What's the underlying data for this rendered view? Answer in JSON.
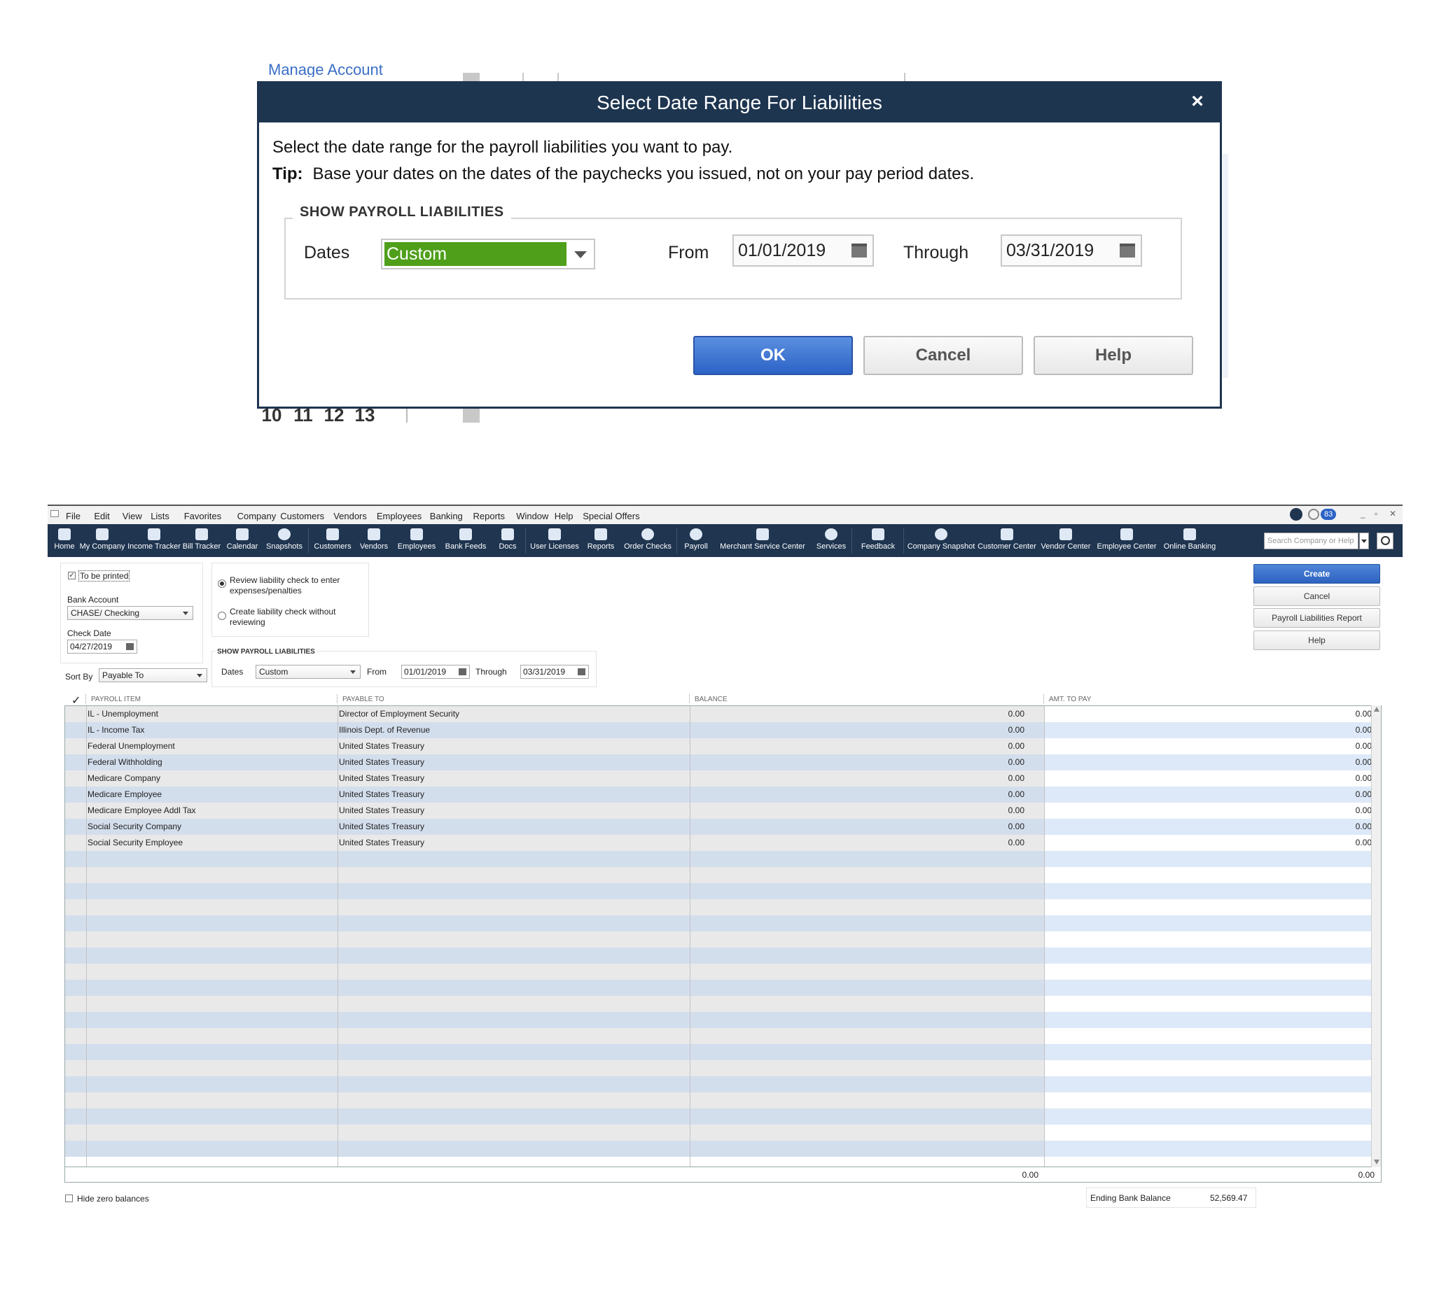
{
  "dialog": {
    "background_link": "Manage Account",
    "background_numbers": [
      "10",
      "11",
      "12",
      "13"
    ],
    "title": "Select Date Range For Liabilities",
    "close": "×",
    "line1": "Select the date range for the payroll liabilities you want to pay.",
    "tip_label": "Tip:",
    "tip_text": "Base your dates on the dates of the paychecks you issued, not on your pay period dates.",
    "group_title": "SHOW PAYROLL LIABILITIES",
    "dates_label": "Dates",
    "dates_value": "Custom",
    "from_label": "From",
    "from_value": "01/01/2019",
    "through_label": "Through",
    "through_value": "03/31/2019",
    "ok": "OK",
    "cancel": "Cancel",
    "help": "Help",
    "colors": {
      "title_bar": "#1e3550",
      "dates_highlight": "#4f9f1a",
      "ok_button": "#2c63c6"
    }
  },
  "qb": {
    "menu": [
      "File",
      "Edit",
      "View",
      "Lists",
      "Favorites",
      "Company",
      "Customers",
      "Vendors",
      "Employees",
      "Banking",
      "Reports",
      "Window",
      "Help",
      "Special Offers"
    ],
    "notification_count": "83",
    "toolbar": [
      "Home",
      "My Company",
      "Income Tracker",
      "Bill Tracker",
      "Calendar",
      "Snapshots",
      "Customers",
      "Vendors",
      "Employees",
      "Bank Feeds",
      "Docs",
      "User Licenses",
      "Reports",
      "Order Checks",
      "Payroll",
      "Merchant Service Center",
      "Services",
      "Feedback",
      "Company Snapshot",
      "Customer Center",
      "Vendor Center",
      "Employee Center",
      "Online Banking"
    ],
    "toolbar_more": "»",
    "search_placeholder": "Search Company or Help",
    "to_be_printed": "To be printed",
    "bank_account_label": "Bank Account",
    "bank_account_value": "CHASE/ Checking",
    "check_date_label": "Check Date",
    "check_date_value": "04/27/2019",
    "radio1": "Review liability check to enter expenses/penalties",
    "radio2": "Create liability check without reviewing",
    "show_title": "SHOW PAYROLL LIABILITIES",
    "dates_label": "Dates",
    "dates_value": "Custom",
    "from_label": "From",
    "from_value": "01/01/2019",
    "through_label": "Through",
    "through_value": "03/31/2019",
    "sort_by_label": "Sort By",
    "sort_by_value": "Payable To",
    "buttons": {
      "create": "Create",
      "cancel": "Cancel",
      "report": "Payroll Liabilities Report",
      "help": "Help"
    },
    "columns": {
      "check": "✓",
      "item": "PAYROLL ITEM",
      "payable": "PAYABLE TO",
      "balance": "BALANCE",
      "amount": "AMT. TO PAY"
    },
    "rows": [
      {
        "item": "IL - Unemployment",
        "payable": "Director of Employment Security",
        "balance": "0.00",
        "amount": "0.00"
      },
      {
        "item": "IL - Income Tax",
        "payable": "Illinois Dept. of Revenue",
        "balance": "0.00",
        "amount": "0.00"
      },
      {
        "item": "Federal Unemployment",
        "payable": "United States Treasury",
        "balance": "0.00",
        "amount": "0.00"
      },
      {
        "item": "Federal Withholding",
        "payable": "United States Treasury",
        "balance": "0.00",
        "amount": "0.00"
      },
      {
        "item": "Medicare Company",
        "payable": "United States Treasury",
        "balance": "0.00",
        "amount": "0.00"
      },
      {
        "item": "Medicare Employee",
        "payable": "United States Treasury",
        "balance": "0.00",
        "amount": "0.00"
      },
      {
        "item": "Medicare Employee Addl Tax",
        "payable": "United States Treasury",
        "balance": "0.00",
        "amount": "0.00"
      },
      {
        "item": "Social Security Company",
        "payable": "United States Treasury",
        "balance": "0.00",
        "amount": "0.00"
      },
      {
        "item": "Social Security Employee",
        "payable": "United States Treasury",
        "balance": "0.00",
        "amount": "0.00"
      }
    ],
    "total_balance": "0.00",
    "total_amount": "0.00",
    "hide_zero": "Hide zero balances",
    "ending_balance_label": "Ending Bank Balance",
    "ending_balance_value": "52,569.47"
  }
}
